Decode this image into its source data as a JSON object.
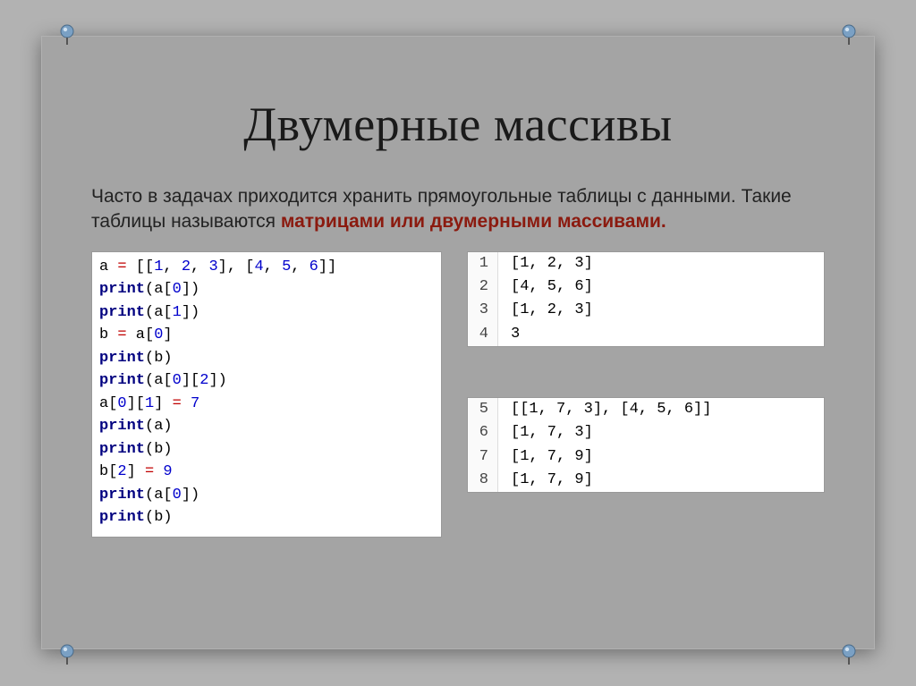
{
  "title": "Двумерные массивы",
  "para_plain": "Часто в задачах приходится хранить прямоугольные таблицы с данными. Такие таблицы называются ",
  "para_hl": "матрицами или двумерными массивами.",
  "code": {
    "l1": {
      "a": "a ",
      "eq": "=",
      "b": " [[",
      "n1": "1",
      "c1": ", ",
      "n2": "2",
      "c2": ", ",
      "n3": "3",
      "c3": "], [",
      "n4": "4",
      "c4": ", ",
      "n5": "5",
      "c5": ", ",
      "n6": "6",
      "c6": "]]"
    },
    "l2": {
      "p": "print",
      "a": "(a[",
      "n": "0",
      "b": "])"
    },
    "l3": {
      "p": "print",
      "a": "(a[",
      "n": "1",
      "b": "])"
    },
    "l4": {
      "a": "b ",
      "eq": "=",
      "b": " a[",
      "n": "0",
      "c": "]"
    },
    "l5": {
      "p": "print",
      "a": "(b)"
    },
    "l6": {
      "p": "print",
      "a": "(a[",
      "n1": "0",
      "b": "][",
      "n2": "2",
      "c": "])"
    },
    "l7": {
      "a": "a[",
      "n1": "0",
      "b": "][",
      "n2": "1",
      "c": "] ",
      "eq": "=",
      "d": " ",
      "n3": "7"
    },
    "l8": {
      "p": "print",
      "a": "(a)"
    },
    "l9": {
      "p": "print",
      "a": "(b)"
    },
    "l10": {
      "a": "b[",
      "n1": "2",
      "b": "] ",
      "eq": "=",
      "c": " ",
      "n2": "9"
    },
    "l11": {
      "p": "print",
      "a": "(a[",
      "n": "0",
      "b": "])"
    },
    "l12": {
      "p": "print",
      "a": "(b)"
    }
  },
  "out1": [
    {
      "n": "1",
      "v": "[1, 2, 3]"
    },
    {
      "n": "2",
      "v": "[4, 5, 6]"
    },
    {
      "n": "3",
      "v": "[1, 2, 3]"
    },
    {
      "n": "4",
      "v": "3"
    }
  ],
  "out2": [
    {
      "n": "5",
      "v": "[[1, 7, 3], [4, 5, 6]]"
    },
    {
      "n": "6",
      "v": "[1, 7, 3]"
    },
    {
      "n": "7",
      "v": "[1, 7, 9]"
    },
    {
      "n": "8",
      "v": "[1, 7, 9]"
    }
  ]
}
